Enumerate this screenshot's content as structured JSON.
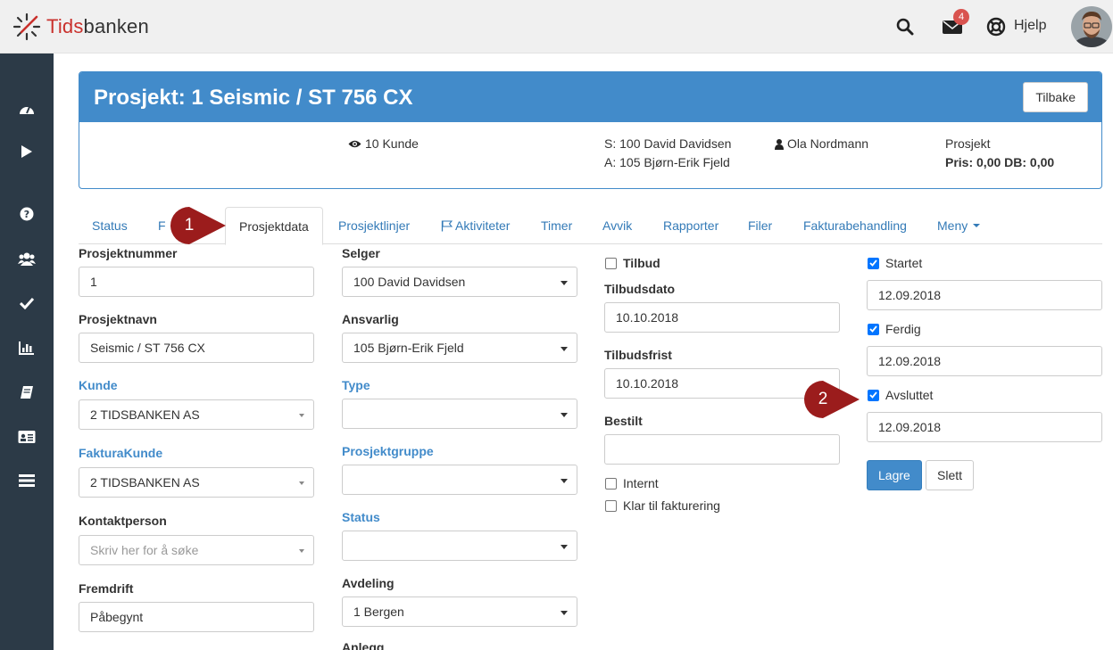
{
  "app": {
    "logo_text_part1": "Tids",
    "logo_text_part2": "banken",
    "mail_count": "4",
    "help_label": "Hjelp"
  },
  "sidebar": {
    "icons": [
      "dashboard-icon",
      "play-icon",
      "help-circle-icon",
      "users-icon",
      "check-icon",
      "bar-chart-icon",
      "book-icon",
      "id-card-icon",
      "list-icon"
    ]
  },
  "project": {
    "title": "Prosjekt: 1 Seismic / ST 756 CX",
    "back_label": "Tilbake",
    "customer": "10 Kunde",
    "seller_line": "S: 100 David Davidsen",
    "responsible_line": "A: 105 Bjørn-Erik Fjeld",
    "contact": "Ola Nordmann",
    "type_label": "Prosjekt",
    "price_line": "Pris: 0,00 DB: 0,00"
  },
  "tabs": [
    {
      "label": "Status"
    },
    {
      "label": "F"
    },
    {
      "label": "Prosjektdata"
    },
    {
      "label": "Prosjektlinjer"
    },
    {
      "label": "Aktiviteter"
    },
    {
      "label": "Timer"
    },
    {
      "label": "Avvik"
    },
    {
      "label": "Rapporter"
    },
    {
      "label": "Filer"
    },
    {
      "label": "Fakturabehandling"
    },
    {
      "label": "Meny"
    }
  ],
  "form": {
    "col1": {
      "prosjektnummer_label": "Prosjektnummer",
      "prosjektnummer_value": "1",
      "prosjektnavn_label": "Prosjektnavn",
      "prosjektnavn_value": "Seismic / ST 756 CX",
      "kunde_label": "Kunde",
      "kunde_value": "2 TIDSBANKEN AS",
      "fakturakunde_label": "FakturaKunde",
      "fakturakunde_value": "2 TIDSBANKEN AS",
      "kontaktperson_label": "Kontaktperson",
      "kontaktperson_placeholder": "Skriv her for å søke",
      "fremdrift_label": "Fremdrift",
      "fremdrift_value": "Påbegynt"
    },
    "col2": {
      "selger_label": "Selger",
      "selger_value": "100 David Davidsen",
      "ansvarlig_label": "Ansvarlig",
      "ansvarlig_value": "105 Bjørn-Erik Fjeld",
      "type_label": "Type",
      "type_value": "",
      "prosjektgruppe_label": "Prosjektgruppe",
      "prosjektgruppe_value": "",
      "status_label": "Status",
      "status_value": "",
      "avdeling_label": "Avdeling",
      "avdeling_value": "1 Bergen",
      "anlegg_label": "Anlegg"
    },
    "col3": {
      "tilbud_label": "Tilbud",
      "tilbud_checked": false,
      "tilbudsdato_label": "Tilbudsdato",
      "tilbudsdato_value": "10.10.2018",
      "tilbudsfrist_label": "Tilbudsfrist",
      "tilbudsfrist_value": "10.10.2018",
      "bestilt_label": "Bestilt",
      "bestilt_value": "",
      "internt_label": "Internt",
      "internt_checked": false,
      "klar_label": "Klar til fakturering",
      "klar_checked": false
    },
    "col4": {
      "startet_label": "Startet",
      "startet_checked": true,
      "startet_value": "12.09.2018",
      "ferdig_label": "Ferdig",
      "ferdig_checked": true,
      "ferdig_value": "12.09.2018",
      "avsluttet_label": "Avsluttet",
      "avsluttet_checked": true,
      "avsluttet_value": "12.09.2018",
      "save_label": "Lagre",
      "delete_label": "Slett"
    }
  },
  "callouts": {
    "first": "1",
    "second": "2"
  },
  "colors": {
    "primary": "#428bca",
    "sidebar": "#2c3a47",
    "callout": "#9b1c1c",
    "badge": "#d9534f"
  }
}
